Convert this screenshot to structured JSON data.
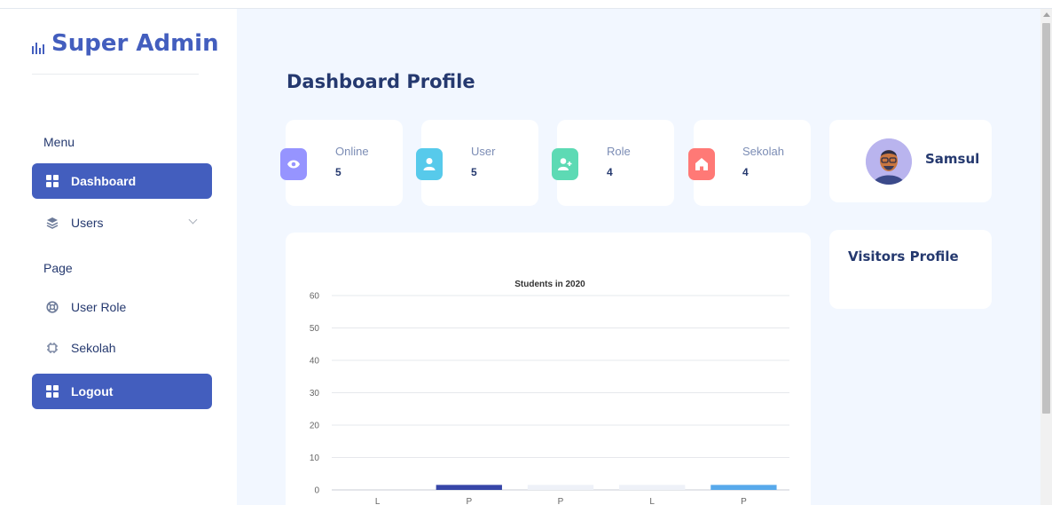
{
  "brand": {
    "title": "Super Admin",
    "icon": "bar-chart-icon"
  },
  "sidebar": {
    "menu_title": "Menu",
    "page_title": "Page",
    "items": [
      {
        "label": "Dashboard",
        "icon": "grid-icon",
        "active": true
      },
      {
        "label": "Users",
        "icon": "stack-icon",
        "expandable": true
      },
      {
        "label": "User Role",
        "icon": "lifebuoy-icon"
      },
      {
        "label": "Sekolah",
        "icon": "cpu-icon"
      },
      {
        "label": "Logout",
        "icon": "grid-icon",
        "active": true
      }
    ]
  },
  "header": {
    "title": "Dashboard Profile"
  },
  "stats": [
    {
      "label": "Online",
      "value": "5",
      "icon": "eye-icon",
      "color": "#9694ff"
    },
    {
      "label": "User",
      "value": "5",
      "icon": "person-icon",
      "color": "#57caeb"
    },
    {
      "label": "Role",
      "value": "4",
      "icon": "person-add-icon",
      "color": "#5ddab4"
    },
    {
      "label": "Sekolah",
      "value": "4",
      "icon": "house-icon",
      "color": "#ff7976"
    }
  ],
  "profile": {
    "name": "Samsul",
    "icon": "avatar-icon"
  },
  "visitors": {
    "title": "Visitors Profile"
  },
  "colors": {
    "primary": "#435ebe",
    "background": "#f2f7ff",
    "text": "#25396f"
  },
  "chart_data": {
    "type": "bar",
    "title": "Students in 2020",
    "categories": [
      "L",
      "P",
      "P",
      "L",
      "P"
    ],
    "values": [
      0,
      1,
      1,
      1,
      1
    ],
    "bar_colors": [
      "#435ebe",
      "#3746a8",
      "#eef1f8",
      "#eef1f8",
      "#57a9eb"
    ],
    "ylim": [
      0,
      60
    ],
    "yticks": [
      0,
      10,
      20,
      30,
      40,
      50,
      60
    ],
    "xlabel": "",
    "ylabel": "",
    "grid": true
  }
}
